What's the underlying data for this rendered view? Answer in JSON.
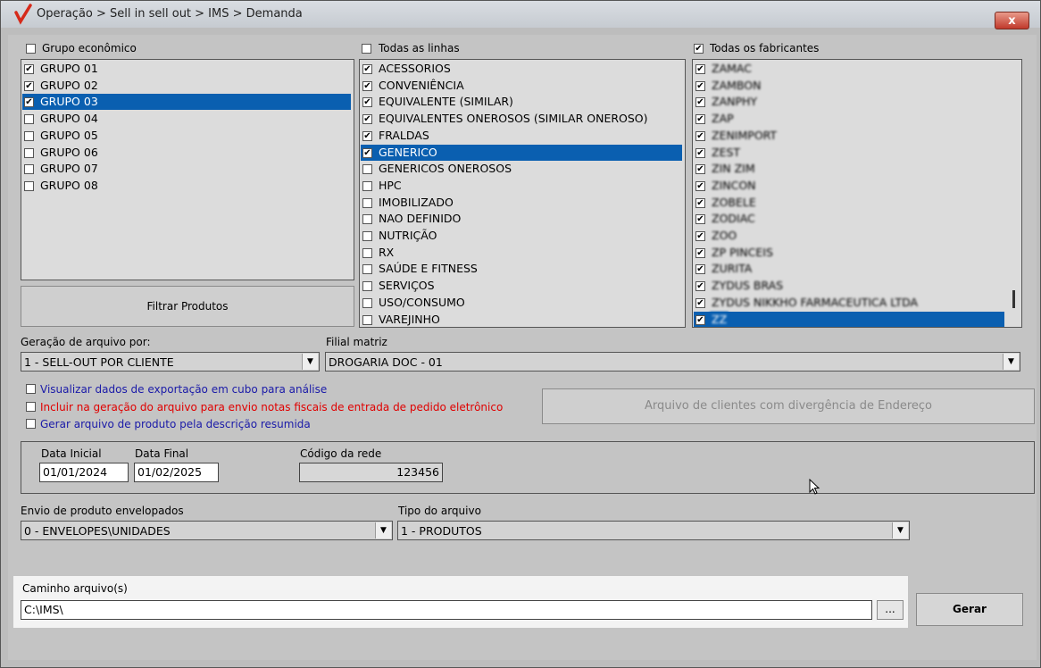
{
  "window": {
    "title": "Operação > Sell in sell out > IMS > Demanda",
    "close": "x"
  },
  "grupo": {
    "header": "Grupo econômico",
    "items": [
      {
        "label": "GRUPO 01",
        "checked": true,
        "selected": false
      },
      {
        "label": "GRUPO 02",
        "checked": true,
        "selected": false
      },
      {
        "label": "GRUPO 03",
        "checked": true,
        "selected": true
      },
      {
        "label": "GRUPO 04",
        "checked": false,
        "selected": false
      },
      {
        "label": "GRUPO 05",
        "checked": false,
        "selected": false
      },
      {
        "label": "GRUPO 06",
        "checked": false,
        "selected": false
      },
      {
        "label": "GRUPO 07",
        "checked": false,
        "selected": false
      },
      {
        "label": "GRUPO 08",
        "checked": false,
        "selected": false
      }
    ]
  },
  "filter_button": "Filtrar Produtos",
  "linhas": {
    "header": "Todas as linhas",
    "items": [
      {
        "label": "ACESSORIOS",
        "checked": true,
        "selected": false
      },
      {
        "label": "CONVENIÊNCIA",
        "checked": true,
        "selected": false
      },
      {
        "label": "EQUIVALENTE (SIMILAR)",
        "checked": true,
        "selected": false
      },
      {
        "label": "EQUIVALENTES ONEROSOS (SIMILAR ONEROSO)",
        "checked": true,
        "selected": false
      },
      {
        "label": "FRALDAS",
        "checked": true,
        "selected": false
      },
      {
        "label": "GENERICO",
        "checked": true,
        "selected": true
      },
      {
        "label": "GENERICOS ONEROSOS",
        "checked": false,
        "selected": false
      },
      {
        "label": "HPC",
        "checked": false,
        "selected": false
      },
      {
        "label": "IMOBILIZADO",
        "checked": false,
        "selected": false
      },
      {
        "label": "NAO DEFINIDO",
        "checked": false,
        "selected": false
      },
      {
        "label": "NUTRIÇÃO",
        "checked": false,
        "selected": false
      },
      {
        "label": "RX",
        "checked": false,
        "selected": false
      },
      {
        "label": "SAÚDE E FITNESS",
        "checked": false,
        "selected": false
      },
      {
        "label": "SERVIÇOS",
        "checked": false,
        "selected": false
      },
      {
        "label": "USO/CONSUMO",
        "checked": false,
        "selected": false
      },
      {
        "label": "VAREJINHO",
        "checked": false,
        "selected": false
      }
    ]
  },
  "fabricantes": {
    "header": "Todas os fabricantes",
    "header_checked": true,
    "items": [
      {
        "label": "ZAMAC",
        "checked": true,
        "selected": false
      },
      {
        "label": "ZAMBON",
        "checked": true,
        "selected": false
      },
      {
        "label": "ZANPHY",
        "checked": true,
        "selected": false
      },
      {
        "label": "ZAP",
        "checked": true,
        "selected": false
      },
      {
        "label": "ZENIMPORT",
        "checked": true,
        "selected": false
      },
      {
        "label": "ZEST",
        "checked": true,
        "selected": false
      },
      {
        "label": "ZIN ZIM",
        "checked": true,
        "selected": false
      },
      {
        "label": "ZINCON",
        "checked": true,
        "selected": false
      },
      {
        "label": "ZOBELE",
        "checked": true,
        "selected": false
      },
      {
        "label": "ZODIAC",
        "checked": true,
        "selected": false
      },
      {
        "label": "ZOO",
        "checked": true,
        "selected": false
      },
      {
        "label": "ZP PINCEIS",
        "checked": true,
        "selected": false
      },
      {
        "label": "ZURITA",
        "checked": true,
        "selected": false
      },
      {
        "label": "ZYDUS BRAS",
        "checked": true,
        "selected": false
      },
      {
        "label": "ZYDUS NIKKHO FARMACEUTICA LTDA",
        "checked": true,
        "selected": false
      },
      {
        "label": "ZZ",
        "checked": true,
        "selected": true
      }
    ]
  },
  "geracao": {
    "label": "Geração de arquivo por:",
    "value": "1 - SELL-OUT POR CLIENTE"
  },
  "filial": {
    "label": "Filial matriz",
    "value": "DROGARIA DOC - 01"
  },
  "options": [
    {
      "label": "Visualizar dados de exportação em cubo para análise",
      "color": "#1a1aa8"
    },
    {
      "label": "Incluir na geração do arquivo para envio notas fiscais de entrada de pedido eletrônico",
      "color": "#e00000"
    },
    {
      "label": "Gerar arquivo de produto pela descrição resumida",
      "color": "#1a1aa8"
    }
  ],
  "divergencia_button": "Arquivo de clientes com divergência de Endereço",
  "datas": {
    "inicial_label": "Data Inicial",
    "inicial_value": "01/01/2024",
    "final_label": "Data Final",
    "final_value": "01/02/2025",
    "rede_label": "Código da rede",
    "rede_value": "123456"
  },
  "envio": {
    "label": "Envio de produto envelopados",
    "value": "0 - ENVELOPES\\UNIDADES"
  },
  "tipo": {
    "label": "Tipo do arquivo",
    "value": "1 - PRODUTOS"
  },
  "caminho": {
    "label": "Caminho arquivo(s)",
    "value": "C:\\IMS\\",
    "browse": "..."
  },
  "gerar_button": "Gerar"
}
